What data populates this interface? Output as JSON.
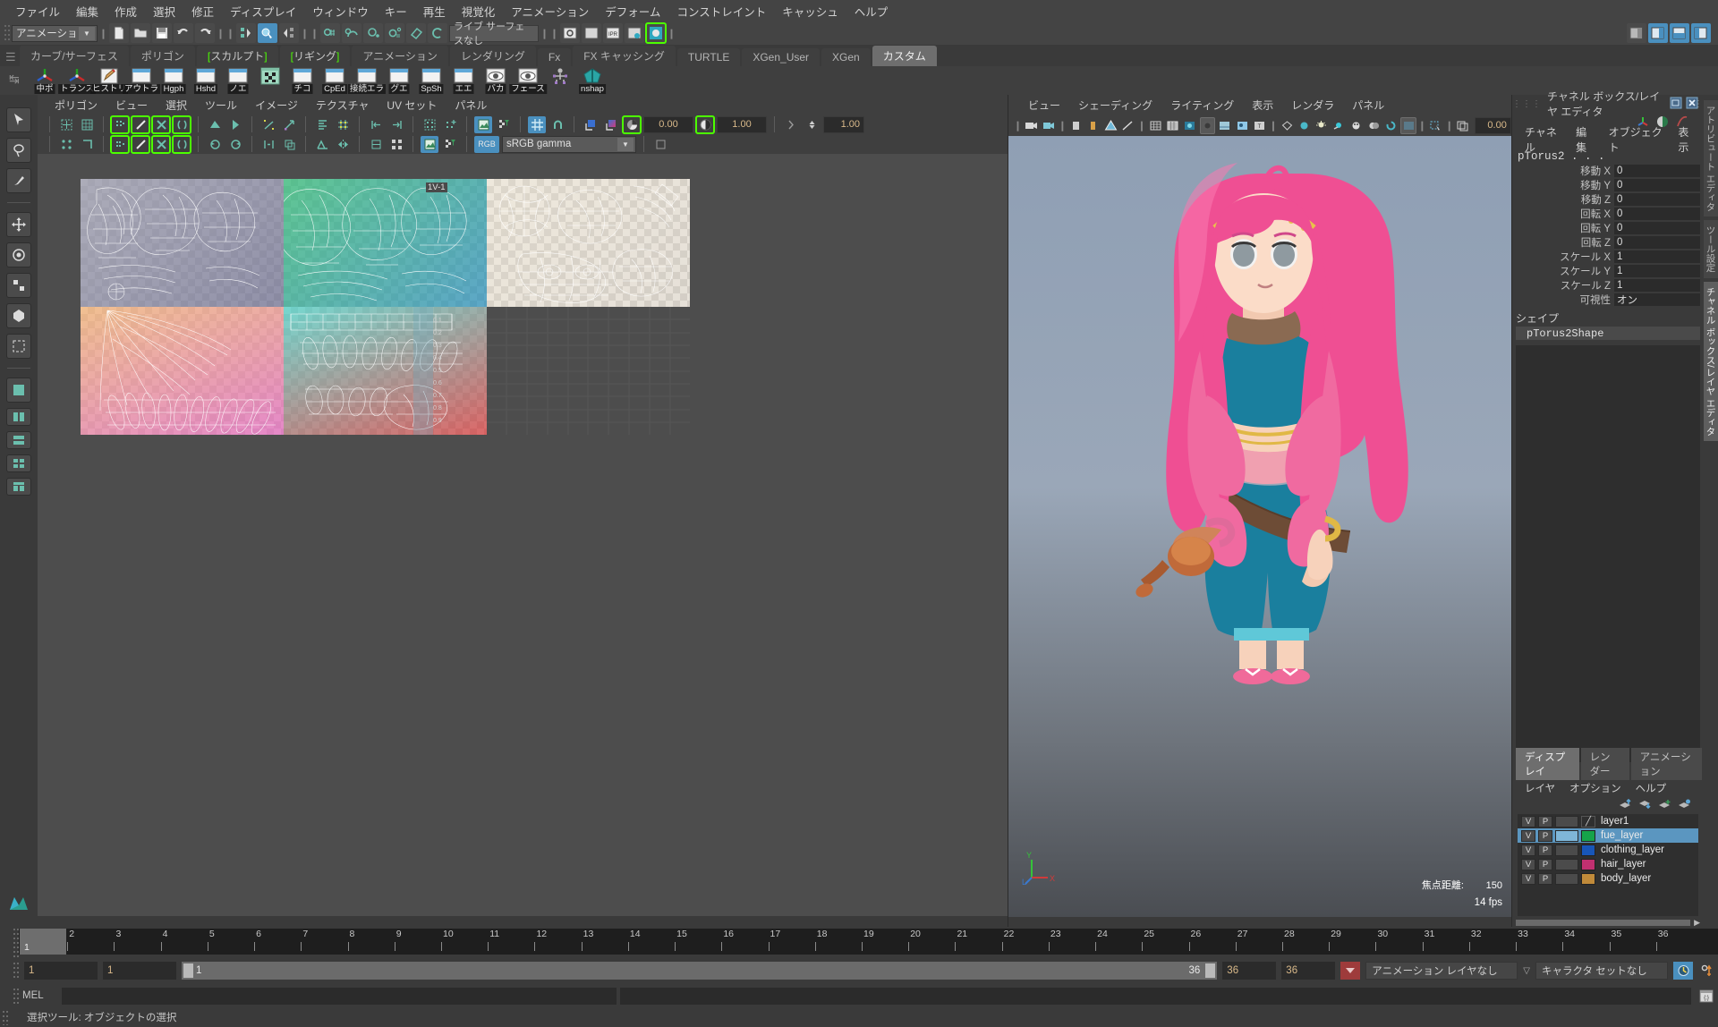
{
  "menubar": {
    "items": [
      "ファイル",
      "編集",
      "作成",
      "選択",
      "修正",
      "ディスプレイ",
      "ウィンドウ",
      "キー",
      "再生",
      "視覚化",
      "アニメーション",
      "デフォーム",
      "コンストレイント",
      "キャッシュ",
      "ヘルプ"
    ]
  },
  "statusbar": {
    "mode_menu": "アニメーション",
    "live_surface": "ライブ サーフェスなし",
    "numeric_field": ""
  },
  "shelf": {
    "tabs": [
      "カーブ/サーフェス",
      "ポリゴン",
      "スカルプト",
      "リギング",
      "アニメーション",
      "レンダリング",
      "Fx",
      "FX キャッシング",
      "TURTLE",
      "XGen_User",
      "XGen",
      "カスタム"
    ],
    "active_tab": "カスタム",
    "bracketed_tabs": [
      "スカルプト",
      "リギング"
    ],
    "icons": [
      {
        "label": "中ポ",
        "type": "axis"
      },
      {
        "label": "トランス",
        "type": "axis"
      },
      {
        "label": "ヒストリ",
        "type": "pencil"
      },
      {
        "label": "アウトラ",
        "type": "window"
      },
      {
        "label": "Hgph",
        "type": "window"
      },
      {
        "label": "Hshd",
        "type": "window"
      },
      {
        "label": "ノエ",
        "type": "window"
      },
      {
        "label": "",
        "type": "checker"
      },
      {
        "label": "チコ",
        "type": "window"
      },
      {
        "label": "CpEd",
        "type": "window"
      },
      {
        "label": "接続エラ",
        "type": "window"
      },
      {
        "label": "グエ",
        "type": "window"
      },
      {
        "label": "SpSh",
        "type": "window"
      },
      {
        "label": "エエ",
        "type": "window"
      },
      {
        "label": "バカ",
        "type": "eye"
      },
      {
        "label": "フェース",
        "type": "eye"
      },
      {
        "label": "",
        "type": "rig"
      },
      {
        "label": "nshap",
        "type": "gem"
      }
    ]
  },
  "uv_editor": {
    "menus": [
      "ポリゴン",
      "ビュー",
      "選択",
      "ツール",
      "イメージ",
      "テクスチャ",
      "UV セット",
      "パネル"
    ],
    "field_left": "0.00",
    "field_right": "1.00",
    "colorspace": "sRGB gamma",
    "exposure": "1.00",
    "tile_label": "1V-1"
  },
  "viewport": {
    "menus": [
      "ビュー",
      "シェーディング",
      "ライティング",
      "表示",
      "レンダラ",
      "パネル"
    ],
    "focal_label": "焦点距離:",
    "focal_value": "150",
    "fps": "14 fps",
    "axis_labels": {
      "y": "Y",
      "x": "X",
      "z": "L"
    },
    "field_value": "0.00"
  },
  "channel_box": {
    "panel_title": "チャネル ボックス/レイヤ エディタ",
    "menus": [
      "チャネル",
      "編集",
      "オブジェクト",
      "表示"
    ],
    "object_name": "pTorus2 . . .",
    "attributes": [
      {
        "name": "移動 X",
        "value": "0"
      },
      {
        "name": "移動 Y",
        "value": "0"
      },
      {
        "name": "移動 Z",
        "value": "0"
      },
      {
        "name": "回転 X",
        "value": "0"
      },
      {
        "name": "回転 Y",
        "value": "0"
      },
      {
        "name": "回転 Z",
        "value": "0"
      },
      {
        "name": "スケール X",
        "value": "1"
      },
      {
        "name": "スケール Y",
        "value": "1"
      },
      {
        "name": "スケール Z",
        "value": "1"
      },
      {
        "name": "可視性",
        "value": "オン"
      }
    ],
    "shape_header": "シェイプ",
    "shape_name": "pTorus2Shape"
  },
  "layer_editor": {
    "tabs": [
      "ディスプレイ",
      "レンダー",
      "アニメーション"
    ],
    "active_tab": "ディスプレイ",
    "menus": [
      "レイヤ",
      "オプション",
      "ヘルプ"
    ],
    "layers": [
      {
        "name": "layer1",
        "v": "V",
        "p": "P",
        "color": "none",
        "selected": false
      },
      {
        "name": "fue_layer",
        "v": "V",
        "p": "P",
        "color": "#16a34a",
        "selected": true
      },
      {
        "name": "clothing_layer",
        "v": "V",
        "p": "P",
        "color": "#1856b8",
        "selected": false
      },
      {
        "name": "hair_layer",
        "v": "V",
        "p": "P",
        "color": "#c03070",
        "selected": false
      },
      {
        "name": "body_layer",
        "v": "V",
        "p": "P",
        "color": "#c08a3a",
        "selected": false
      }
    ]
  },
  "vertical_tabs": {
    "items": [
      "アトリビュート エディタ",
      "ツール設定",
      "チャネル ボックス/レイヤ エディタ"
    ],
    "active": "チャネル ボックス/レイヤ エディタ"
  },
  "timeline": {
    "frames": [
      "1",
      "2",
      "3",
      "4",
      "5",
      "6",
      "7",
      "8",
      "9",
      "10",
      "11",
      "12",
      "13",
      "14",
      "15",
      "16",
      "17",
      "18",
      "19",
      "20",
      "21",
      "22",
      "23",
      "24",
      "25",
      "26",
      "27",
      "28",
      "29",
      "30",
      "31",
      "32",
      "33",
      "34",
      "35",
      "36"
    ],
    "current_frame": "1",
    "current_frame_field": "1"
  },
  "range_bar": {
    "start": "1",
    "range_start": "1",
    "slider_label": "1",
    "end_display": "36",
    "range_end": "36",
    "end": "36",
    "anim_layer": "アニメーション レイヤなし",
    "character_set": "キャラクタ セットなし"
  },
  "command_line": {
    "label": "MEL",
    "input": "",
    "output": ""
  },
  "status_line": {
    "text": "選択ツール: オブジェクトの選択"
  },
  "colors": {
    "accent_blue": "#4a90bf",
    "highlight_green": "#4cff00",
    "panel_bg": "#3a3a3a",
    "field_bg": "#2b2b2b",
    "selection_blue": "#5b96c0"
  }
}
